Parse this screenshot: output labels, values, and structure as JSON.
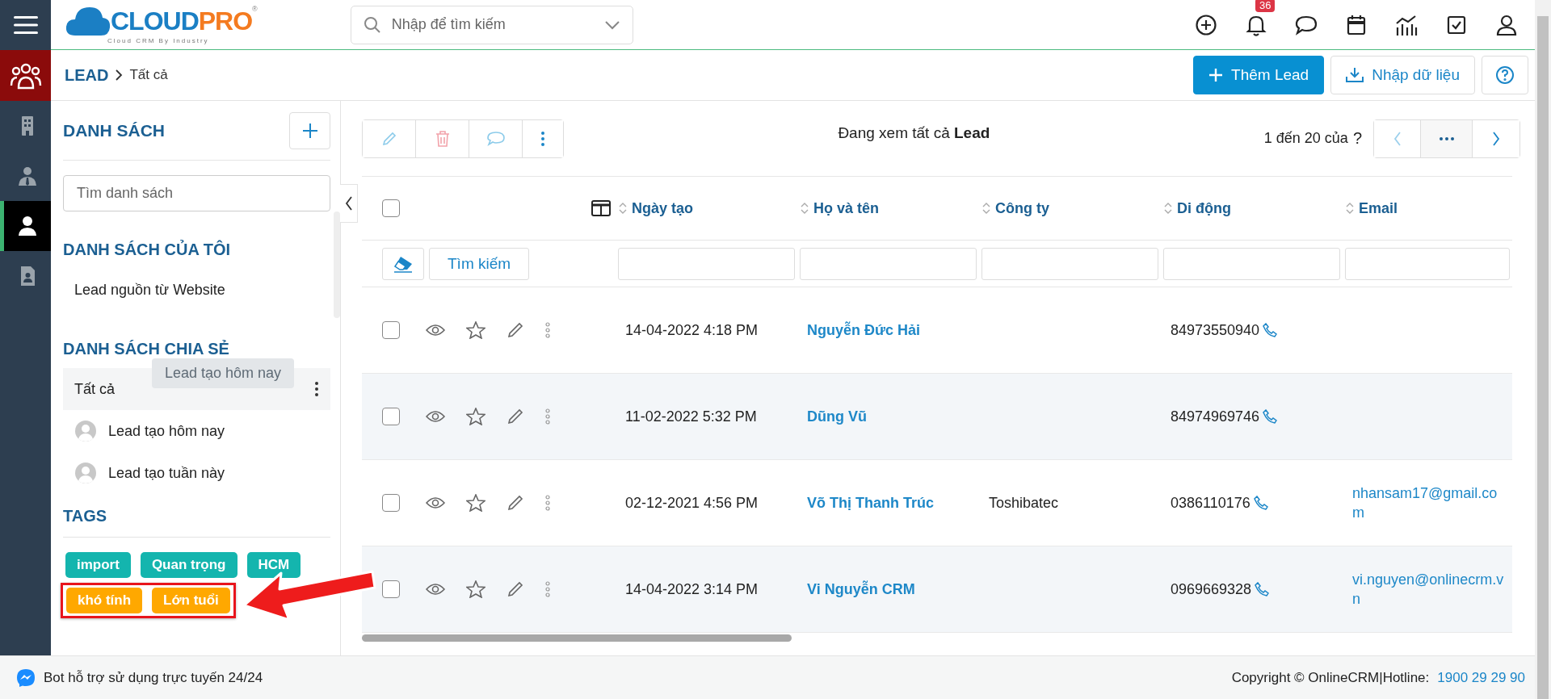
{
  "rail": {
    "items": [
      {
        "kind": "building",
        "selected": false
      },
      {
        "kind": "agent",
        "selected": false
      },
      {
        "kind": "person",
        "selected": true
      },
      {
        "kind": "document",
        "selected": false
      }
    ]
  },
  "topbar": {
    "logo": {
      "part1": "CLOUD",
      "part2": "PRO",
      "mark": "®",
      "tagline": "Cloud CRM By Industry"
    },
    "search": {
      "placeholder": "Nhập để tìm kiếm"
    },
    "notification_badge": "36"
  },
  "breadcrumb": {
    "module": "LEAD",
    "current": "Tất cả"
  },
  "actions": [
    {
      "kind": "primary",
      "label": "Thêm Lead"
    },
    {
      "kind": "import",
      "label": "Nhập dữ liệu"
    },
    {
      "kind": "help"
    }
  ],
  "sidebar": {
    "title": "DANH SÁCH",
    "search": {
      "placeholder": "Tìm danh sách"
    },
    "sections": [
      {
        "title": "DANH SÁCH CỦA TÔI",
        "items": [
          {
            "label": "Lead nguồn từ Website",
            "selected": false,
            "avatar": false
          }
        ]
      },
      {
        "title": "DANH SÁCH CHIA SẺ",
        "items": [
          {
            "label": "Tất cả",
            "selected": true,
            "avatar": false,
            "tooltip": "Lead tạo hôm nay"
          },
          {
            "label": "Lead tạo hôm nay",
            "selected": false,
            "avatar": true
          },
          {
            "label": "Lead tạo tuần này",
            "selected": false,
            "avatar": true
          }
        ]
      }
    ],
    "tags_title": "TAGS",
    "tags": [
      {
        "label": "import",
        "color": "#14b5ae",
        "highlighted": false
      },
      {
        "label": "Quan trọng",
        "color": "#14b5ae",
        "highlighted": false
      },
      {
        "label": "HCM",
        "color": "#14b5ae",
        "highlighted": false
      },
      {
        "label": "khó tính",
        "color": "#ffa800",
        "highlighted": true
      },
      {
        "label": "Lớn tuổi",
        "color": "#ffa800",
        "highlighted": true
      }
    ]
  },
  "list": {
    "heading": "Đang xem tất cả **Lead**",
    "pager": {
      "range": "1 đến 20 của",
      "total": "?"
    },
    "columns": [
      "Ngày tạo",
      "Họ và tên",
      "Công ty",
      "Di động",
      "Email"
    ],
    "select_all_checked": false,
    "search_button": "Tìm kiếm",
    "rows": [
      {
        "checked": false,
        "created": "14-04-2022 4:18 PM",
        "name": "Nguyễn Đức Hải",
        "mobile": "84973550940"
      },
      {
        "checked": false,
        "created": "11-02-2022 5:32 PM",
        "name": "Dũng Vũ",
        "mobile": "84974969746"
      },
      {
        "checked": false,
        "created": "02-12-2021 4:56 PM",
        "name": "Võ Thị Thanh Trúc",
        "company": "Toshibatec",
        "mobile": "0386110176",
        "email": "nhansam17@gmail.com"
      },
      {
        "checked": false,
        "created": "14-04-2022 3:14 PM",
        "name": "Vi Nguyễn CRM",
        "mobile": "0969669328",
        "email": "vi.nguyen@onlinecrm.vn"
      }
    ]
  },
  "footer": {
    "bot": "Bot hỗ trợ sử dụng trực tuyến 24/24",
    "copyright": "Copyright © OnlineCRM|Hotline:",
    "hotline": "1900 29 29 90"
  }
}
